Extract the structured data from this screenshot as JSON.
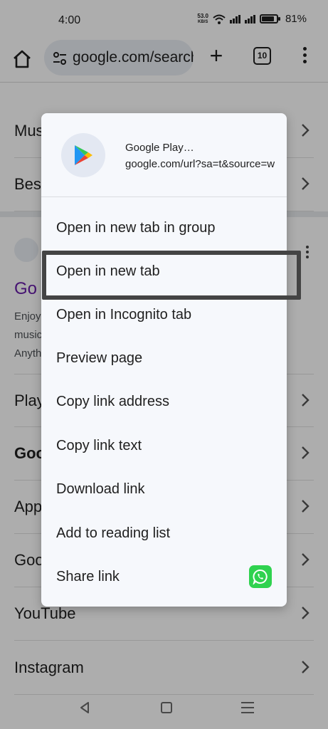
{
  "status_bar": {
    "time": "4:00",
    "net_speed_value": "53.0",
    "net_speed_unit": "KB/S",
    "battery_percent": "81%"
  },
  "toolbar": {
    "url": "google.com/search",
    "tab_count": "10"
  },
  "background_page": {
    "rows_top": [
      "Music",
      "Best"
    ],
    "result": {
      "title": "Go",
      "snippet_lines": [
        "Enjoy",
        "music",
        "Anyth"
      ]
    },
    "rows_bottom": [
      "Play",
      "Goo",
      "App",
      "Goo",
      "YouTube",
      "Instagram"
    ]
  },
  "context_menu": {
    "site_title": "Google Play…",
    "site_url": "google.com/url?sa=t&source=web",
    "items": [
      "Open in new tab in group",
      "Open in new tab",
      "Open in Incognito tab",
      "Preview page",
      "Copy link address",
      "Copy link text",
      "Download link",
      "Add to reading list",
      "Share link"
    ]
  },
  "colors": {
    "accent_purple": "#681da8",
    "whatsapp_green": "#2fd24f",
    "highlight_border": "#444444"
  }
}
